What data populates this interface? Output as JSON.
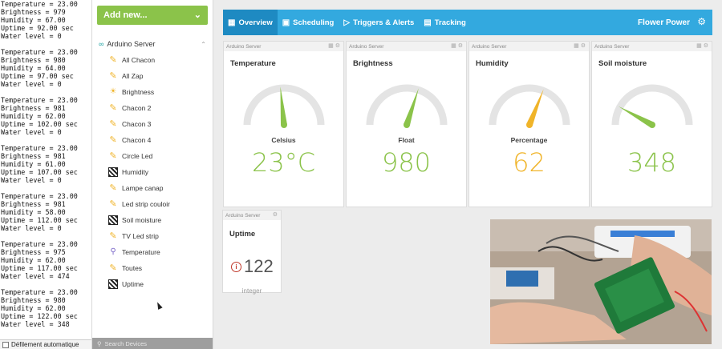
{
  "serial": {
    "lines": [
      "Temperature = 23.00",
      "Brightness = 979",
      "Humidity = 67.00",
      "Uptime = 92.00 sec",
      "Water level = 0",
      "",
      "Temperature = 23.00",
      "Brightness = 980",
      "Humidity = 64.00",
      "Uptime = 97.00 sec",
      "Water level = 0",
      "",
      "Temperature = 23.00",
      "Brightness = 981",
      "Humidity = 62.00",
      "Uptime = 102.00 sec",
      "Water level = 0",
      "",
      "Temperature = 23.00",
      "Brightness = 981",
      "Humidity = 61.00",
      "Uptime = 107.00 sec",
      "Water level = 0",
      "",
      "Temperature = 23.00",
      "Brightness = 981",
      "Humidity = 58.00",
      "Uptime = 112.00 sec",
      "Water level = 0",
      "",
      "Temperature = 23.00",
      "Brightness = 975",
      "Humidity = 62.00",
      "Uptime = 117.00 sec",
      "Water level = 474",
      "",
      "Temperature = 23.00",
      "Brightness = 980",
      "Humidity = 62.00",
      "Uptime = 122.00 sec",
      "Water level = 348"
    ],
    "autoscroll_label": "Défilement automatique"
  },
  "sidebar": {
    "add_new_label": "Add new...",
    "group_label": "Arduino Server",
    "search_placeholder": "Search Devices",
    "devices": [
      {
        "label": "All Chacon",
        "icon": "wrench-icon"
      },
      {
        "label": "All Zap",
        "icon": "wrench-icon"
      },
      {
        "label": "Brightness",
        "icon": "sun-icon"
      },
      {
        "label": "Chacon 2",
        "icon": "wrench-icon"
      },
      {
        "label": "Chacon 3",
        "icon": "wrench-icon"
      },
      {
        "label": "Chacon 4",
        "icon": "wrench-icon"
      },
      {
        "label": "Circle Led",
        "icon": "wrench-icon"
      },
      {
        "label": "Humidity",
        "icon": "striped-sensor-icon"
      },
      {
        "label": "Lampe canap",
        "icon": "wrench-icon"
      },
      {
        "label": "Led strip couloir",
        "icon": "wrench-icon"
      },
      {
        "label": "Soil moisture",
        "icon": "striped-sensor-icon"
      },
      {
        "label": "TV Led strip",
        "icon": "wrench-icon"
      },
      {
        "label": "Temperature",
        "icon": "thermometer-icon"
      },
      {
        "label": "Toutes",
        "icon": "wrench-icon"
      },
      {
        "label": "Uptime",
        "icon": "striped-sensor-icon"
      }
    ]
  },
  "topbar": {
    "tabs": [
      {
        "label": "Overview",
        "icon": "grid-icon",
        "active": true
      },
      {
        "label": "Scheduling",
        "icon": "calendar-icon",
        "active": false
      },
      {
        "label": "Triggers & Alerts",
        "icon": "play-circle-icon",
        "active": false
      },
      {
        "label": "Tracking",
        "icon": "book-icon",
        "active": false
      }
    ],
    "brand": "Flower Power"
  },
  "widgets": [
    {
      "source": "Arduino Server",
      "title": "Temperature",
      "unit": "Celsius",
      "value": "23°C",
      "gauge_fraction": 0.47,
      "color": "#8bc34a"
    },
    {
      "source": "Arduino Server",
      "title": "Brightness",
      "unit": "Float",
      "value": "980",
      "gauge_fraction": 0.6,
      "color": "#8bc34a"
    },
    {
      "source": "Arduino Server",
      "title": "Humidity",
      "unit": "Percentage",
      "value": "62",
      "gauge_fraction": 0.62,
      "color": "#f0b429"
    },
    {
      "source": "Arduino Server",
      "title": "Soil moisture",
      "unit": "",
      "value": "348",
      "gauge_fraction": 0.16,
      "color": "#8bc34a"
    }
  ],
  "uptime_widget": {
    "source": "Arduino Server",
    "title": "Uptime",
    "value": "122",
    "unit": "integer"
  }
}
